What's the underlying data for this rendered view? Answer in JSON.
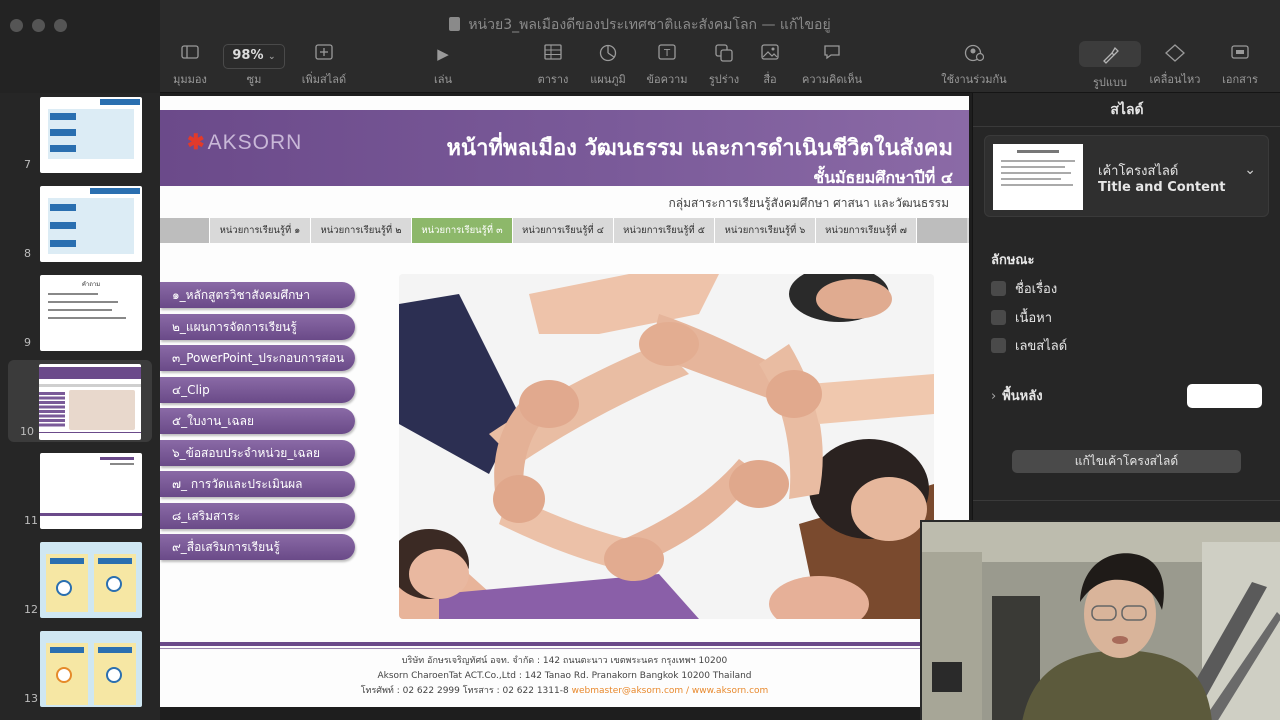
{
  "window": {
    "title": "หน่วย3_พลเมืองดีของประเทศชาติและสังคมโลก — แก้ไขอยู่"
  },
  "toolbar": {
    "items": [
      {
        "label": "มุมมอง",
        "icon": "sidebar-icon"
      },
      {
        "label": "ซูม",
        "value": "98%",
        "icon": "chevron-down-icon"
      },
      {
        "label": "เพิ่มสไลด์",
        "icon": "add-slide-icon"
      },
      {
        "label": "เล่น",
        "icon": "play-icon"
      },
      {
        "label": "ตาราง",
        "icon": "table-icon"
      },
      {
        "label": "แผนภูมิ",
        "icon": "chart-icon"
      },
      {
        "label": "ข้อความ",
        "icon": "text-icon"
      },
      {
        "label": "รูปร่าง",
        "icon": "shape-icon"
      },
      {
        "label": "สื่อ",
        "icon": "media-icon"
      },
      {
        "label": "ความคิดเห็น",
        "icon": "comment-icon"
      },
      {
        "label": "ใช้งานร่วมกัน",
        "icon": "collaborate-icon"
      },
      {
        "label": "รูปแบบ",
        "icon": "format-icon"
      },
      {
        "label": "เคลื่อนไหว",
        "icon": "animate-icon"
      },
      {
        "label": "เอกสาร",
        "icon": "document-icon"
      }
    ]
  },
  "navigator": {
    "slides": [
      {
        "number": "7"
      },
      {
        "number": "8"
      },
      {
        "number": "9",
        "caption": "คำถาม"
      },
      {
        "number": "10",
        "selected": true
      },
      {
        "number": "11"
      },
      {
        "number": "12"
      },
      {
        "number": "13"
      }
    ]
  },
  "slide": {
    "logo": "AKSORN",
    "title": "หน้าที่พลเมือง วัฒนธรรม และการดำเนินชีวิตในสังคม",
    "subtitle": "ชั้นมัธยมศึกษาปีที่ ๔",
    "group": "กลุ่มสาระการเรียนรู้สังคมศึกษา ศาสนา และวัฒนธรรม",
    "tabs": [
      "หน่วยการเรียนรู้ที่ ๑",
      "หน่วยการเรียนรู้ที่ ๒",
      "หน่วยการเรียนรู้ที่ ๓",
      "หน่วยการเรียนรู้ที่ ๔",
      "หน่วยการเรียนรู้ที่ ๕",
      "หน่วยการเรียนรู้ที่ ๖",
      "หน่วยการเรียนรู้ที่ ๗"
    ],
    "active_tab": "หน่วยการเรียนรู้ที่ ๓",
    "menu": [
      "๑_หลักสูตรวิชาสังคมศึกษา",
      "๒_แผนการจัดการเรียนรู้",
      "๓_PowerPoint_ประกอบการสอน",
      "๔_Clip",
      "๕_ใบงาน_เฉลย",
      "๖_ข้อสอบประจำหน่วย_เฉลย",
      "๗_ การวัดและประเมินผล",
      "๘_เสริมสาระ",
      "๙_สื่อเสริมการเรียนรู้"
    ],
    "footer": {
      "line1": "บริษัท อักษรเจริญทัศน์ อจท. จำกัด : 142 ถนนตะนาว เขตพระนคร กรุงเทพฯ 10200",
      "line2": "Aksorn CharoenTat ACT.Co.,Ltd : 142 Tanao Rd. Pranakorn Bangkok 10200 Thailand",
      "line3_prefix": "โทรศัพท์ : 02 622 2999  โทรสาร : 02 622 1311-8",
      "line3_contact": "webmaster@aksorn.com / www.aksorn.com"
    }
  },
  "inspector": {
    "header": "สไลด์",
    "layout_label": "เค้าโครงสไลด์",
    "layout_name": "Title and Content",
    "appearance_label": "ลักษณะ",
    "checkboxes": [
      "ชื่อเรื่อง",
      "เนื้อหา",
      "เลขสไลด์"
    ],
    "background_label": "พื้นหลัง",
    "edit_button": "แก้ไขเค้าโครงสไลด์"
  },
  "colors": {
    "slide_purple": "#6b4a8a",
    "active_tab": "#8db86a",
    "footer_accent": "#e8892d"
  }
}
